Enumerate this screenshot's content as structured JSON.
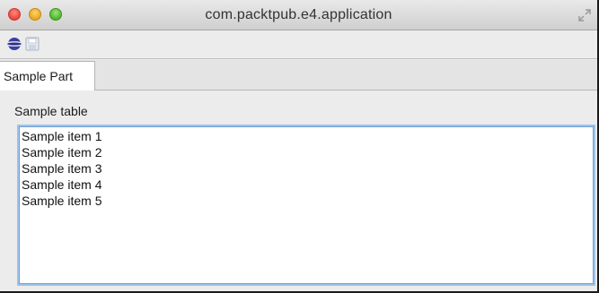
{
  "window": {
    "title": "com.packtpub.e4.application"
  },
  "toolbar": {
    "buttons": [
      "e4-icon",
      "save-icon"
    ]
  },
  "tabs": [
    {
      "label": "Sample Part",
      "active": true
    }
  ],
  "part": {
    "table_label": "Sample table",
    "items": [
      "Sample item 1",
      "Sample item 2",
      "Sample item 3",
      "Sample item 4",
      "Sample item 5"
    ]
  },
  "colors": {
    "focus_ring": "#6fa0d6",
    "window_bg": "#ececec"
  }
}
